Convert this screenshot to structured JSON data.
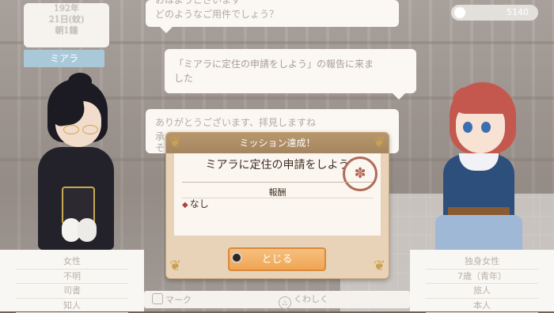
{
  "date": {
    "year": "192年",
    "day": "21日(",
    "day_suffix": "蚊)",
    "time": "朝1鐘"
  },
  "speaker": {
    "name": "ミアラ"
  },
  "money": {
    "value": "5140"
  },
  "dialogue": {
    "line1a": "おはようございます",
    "line1b": "どのようなご用件でしょう？",
    "line2": "「ミアラに定住の申請をしよう」の報告に来ま",
    "line2b": "した",
    "line3": "ありがとうございます、拝見しますね",
    "line3b": "承",
    "line3c": "そ"
  },
  "mission_dialog": {
    "header": "ミッション達成！",
    "title": "ミアラに定住の申請をしよう",
    "reward_label": "報酬",
    "reward_item": "なし",
    "close_label": "とじる"
  },
  "left_info": [
    "女性",
    "不明",
    "司書",
    "知人"
  ],
  "right_info": [
    "独身女性",
    "7歳（青年）",
    "旅人",
    "本人"
  ],
  "bottom_bar": {
    "mark_label": "マーク",
    "detail_label": "くわしく"
  },
  "icons": {
    "square_button": "square-button-icon",
    "triangle_button": "triangle-button-icon",
    "circle_button": "circle-button-icon",
    "coin": "coin-icon",
    "seal": "seal-icon"
  },
  "colors": {
    "accent_orange": "#f0a553",
    "header_brown": "#a48560",
    "reward_diamond": "#b0413a"
  }
}
